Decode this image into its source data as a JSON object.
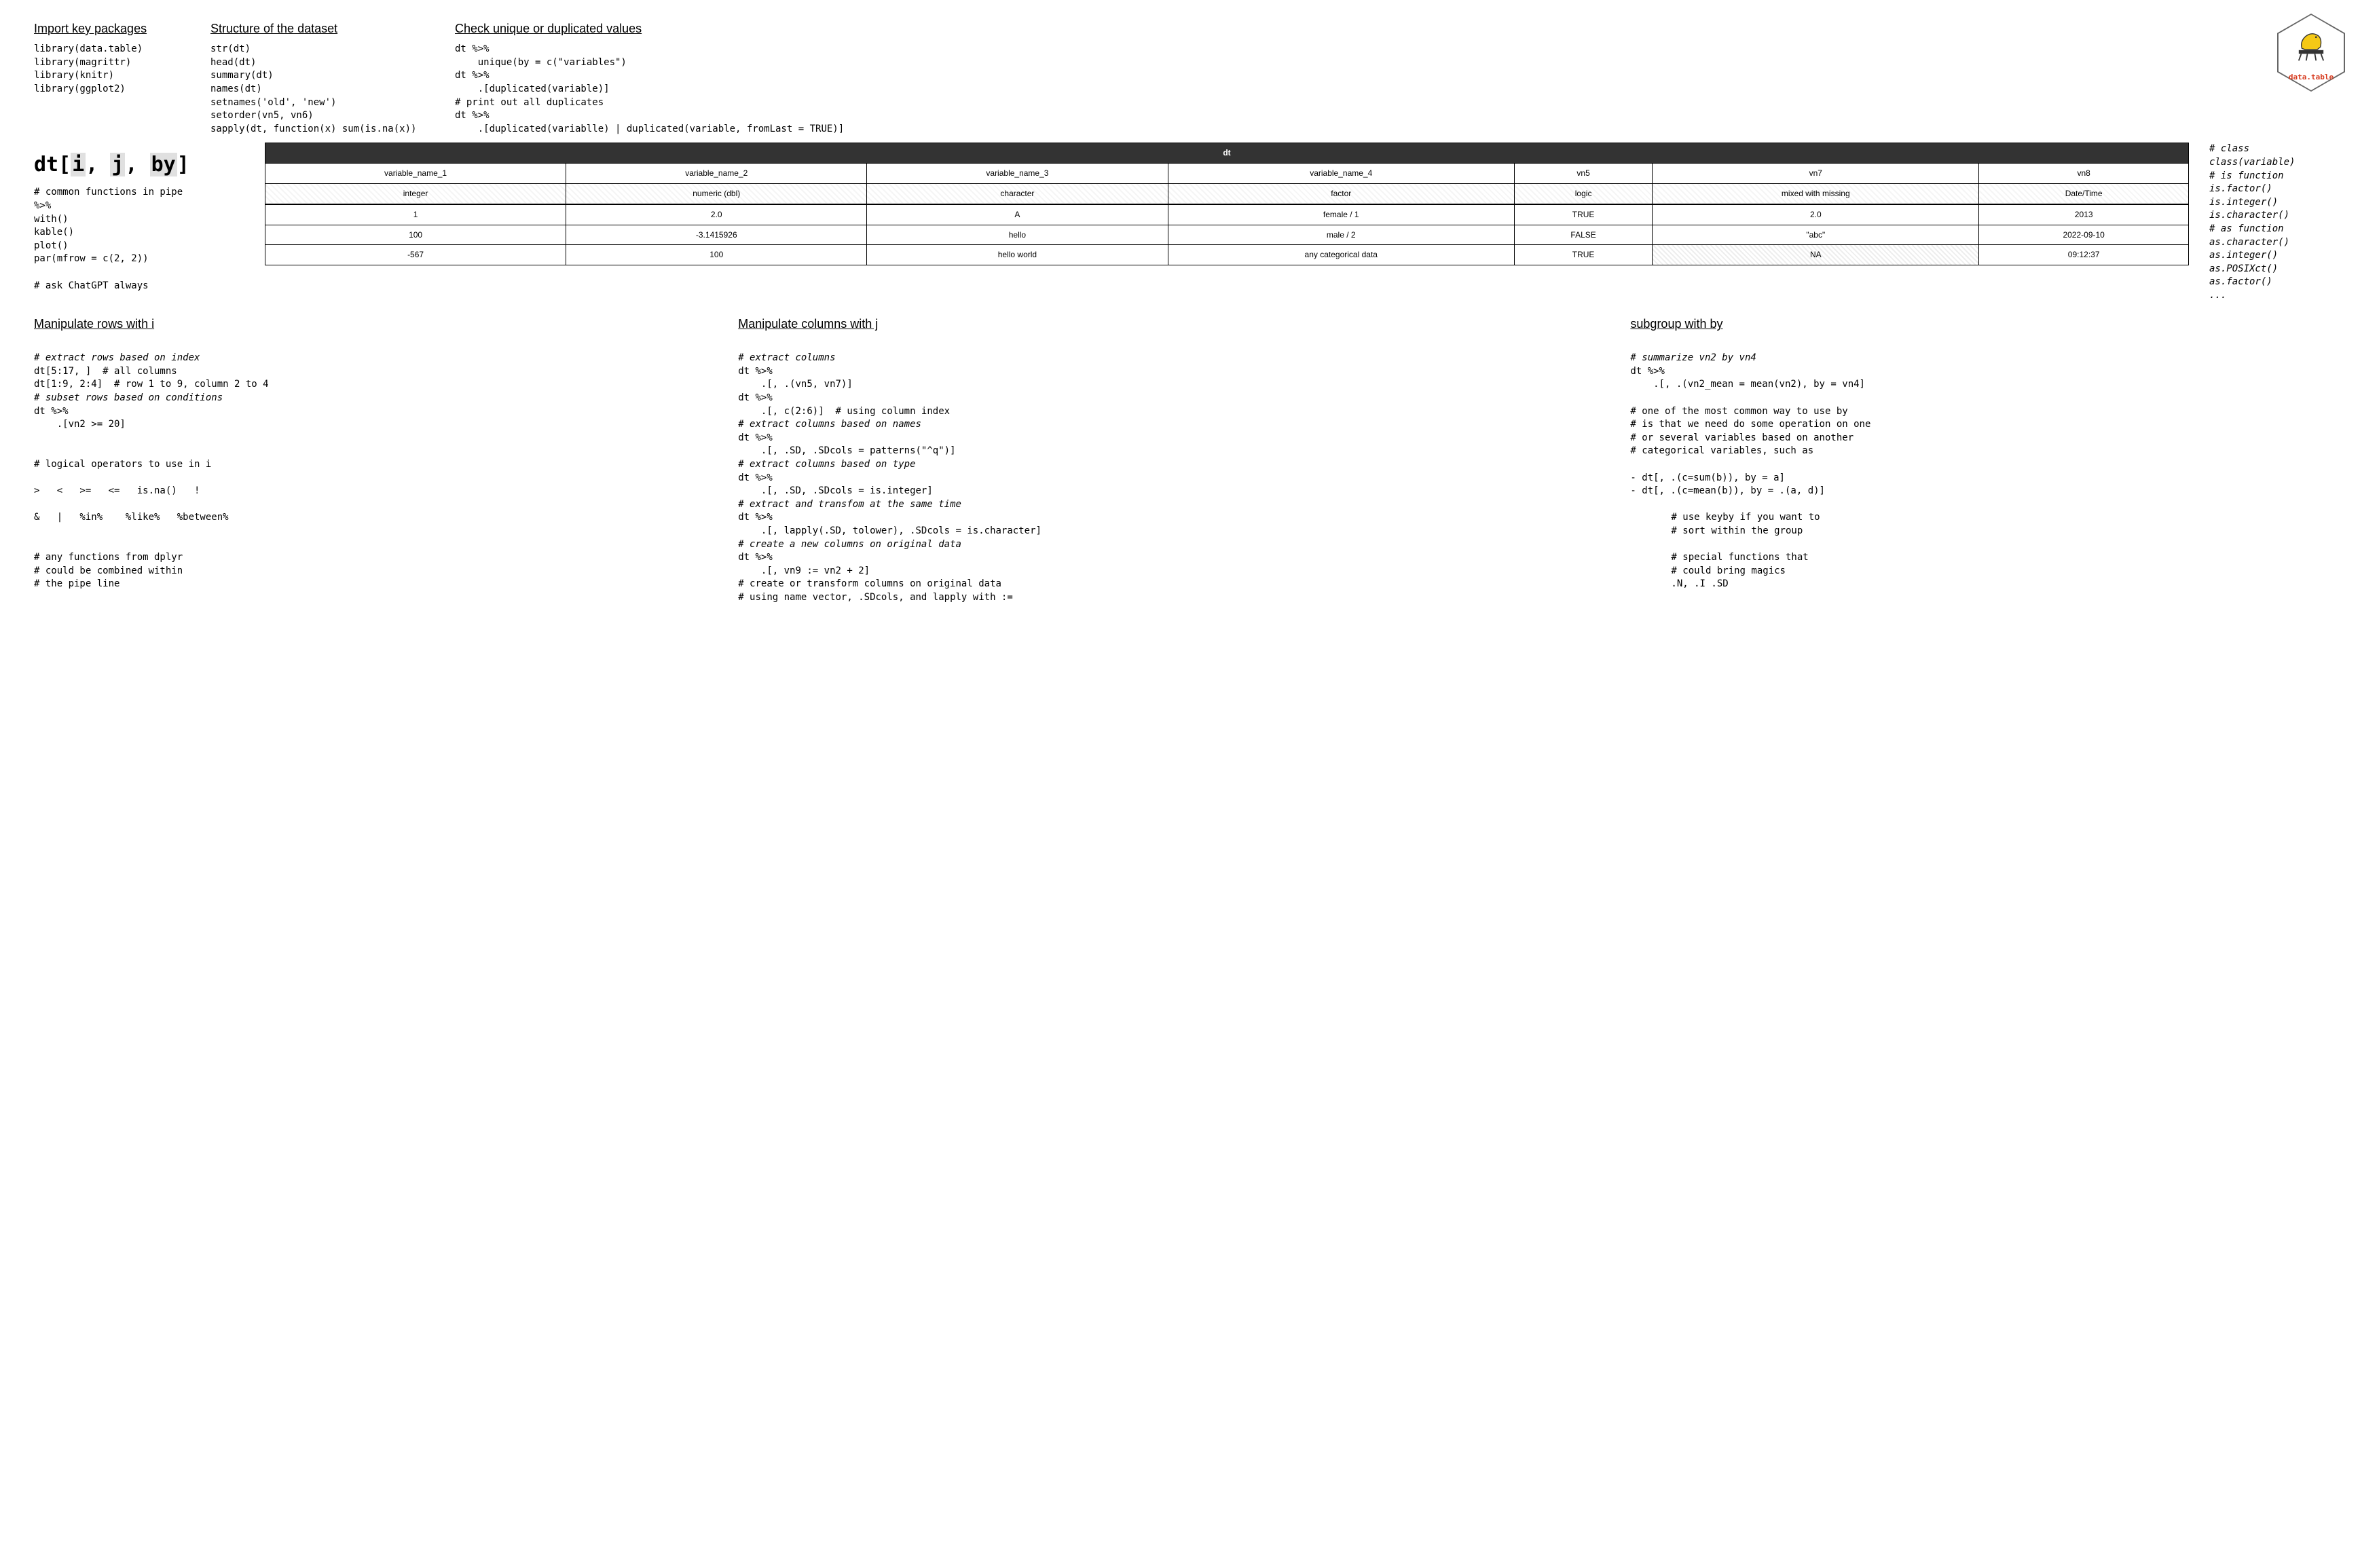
{
  "logo": {
    "label": "data.table"
  },
  "top": {
    "import": {
      "heading": "Import key packages",
      "code": "library(data.table)\nlibrary(magrittr)\nlibrary(knitr)\nlibrary(ggplot2)"
    },
    "structure": {
      "heading": "Structure of the dataset",
      "code": "str(dt)\nhead(dt)\nsummary(dt)\nnames(dt)\nsetnames('old', 'new')\nsetorder(vn5, vn6)\nsapply(dt, function(x) sum(is.na(x))"
    },
    "unique": {
      "heading": "Check unique or duplicated values",
      "code": "dt %>%\n    unique(by = c(\"variables\")\ndt %>%\n    .[duplicated(variable)]\n# print out all duplicates\ndt %>%\n    .[duplicated(variablle) | duplicated(variable, fromLast = TRUE)]"
    }
  },
  "syntax": {
    "prefix": "dt[",
    "i": "i",
    "c1": ", ",
    "j": "j",
    "c2": ", ",
    "by": "by",
    "suffix": "]"
  },
  "leftmid": {
    "common_comment": "# common functions in pipe",
    "common_code": "%>%\nwith()\nkable()\nplot()\npar(mfrow = c(2, 2))",
    "ask": "# ask ChatGPT always"
  },
  "table": {
    "title": "dt",
    "colnames": [
      "variable_name_1",
      "variable_name_2",
      "variable_name_3",
      "variable_name_4",
      "vn5",
      "vn7",
      "vn8"
    ],
    "types": [
      "integer",
      "numeric (dbl)",
      "character",
      "factor",
      "logic",
      "mixed with missing",
      "Date/Time"
    ],
    "rows": [
      [
        "1",
        "2.0",
        "A",
        "female / 1",
        "TRUE",
        "2.0",
        "2013"
      ],
      [
        "100",
        "-3.1415926",
        "hello",
        "male / 2",
        "FALSE",
        "\"abc\"",
        "2022-09-10"
      ],
      [
        "-567",
        "100",
        "hello world",
        "any categorical data",
        "TRUE",
        "NA",
        "09:12:37"
      ]
    ]
  },
  "rightmid": {
    "code": "# class\nclass(variable)\n# is function\nis.factor()\nis.integer()\nis.character()\n# as function\nas.character()\nas.integer()\nas.POSIXct()\nas.factor()\n..."
  },
  "bottom": {
    "i": {
      "heading": "Manipulate rows with i",
      "c1": "# extract rows based on index",
      "l1": "dt[5:17, ]  # all columns",
      "l2": "dt[1:9, 2:4]  # row 1 to 9, column 2 to 4",
      "c2": "# subset rows based on conditions",
      "l3": "dt %>%\n    .[vn2 >= 20]",
      "l4": "# logical operators to use in i",
      "ops1": ">   <   >=   <=   is.na()   !",
      "ops2": "&   |   %in%    %like%   %between%",
      "tail": "# any functions from dplyr\n# could be combined within\n# the pipe line"
    },
    "j": {
      "heading": "Manipulate columns with j",
      "c1": "# extract columns",
      "l1": "dt %>%\n    .[, .(vn5, vn7)]\ndt %>%",
      "l1b": "    .[, c(2:6)]  # using column index",
      "c2": "# extract columns based on names",
      "l2": "dt %>%\n    .[, .SD, .SDcols = patterns(\"^q\")]",
      "c3": "# extract columns based on type",
      "l3": "dt %>%\n    .[, .SD, .SDcols = is.integer]",
      "c4": "# extract and transfom at the same time",
      "l4": "dt %>%\n    .[, lapply(.SD, tolower), .SDcols = is.character]",
      "c5": "# create a new columns on original data",
      "l5": "dt %>%\n    .[, vn9 := vn2 + 2]",
      "tail": "# create or transform columns on original data\n# using name vector, .SDcols, and lapply with :="
    },
    "by": {
      "heading": "subgroup with by",
      "c1": "# summarize vn2 by vn4",
      "l1": "dt %>%\n    .[, .(vn2_mean = mean(vn2), by = vn4]",
      "mid": "# one of the most common way to use by\n# is that we need do some operation on one\n# or several variables based on another\n# categorical variables, such as",
      "ex": "- dt[, .(c=sum(b)), by = a]\n- dt[, .(c=mean(b)), by = .(a, d)]",
      "key": "# use keyby if you want to\n# sort within the group",
      "special": "# special functions that\n# could bring magics\n.N, .I .SD"
    }
  }
}
